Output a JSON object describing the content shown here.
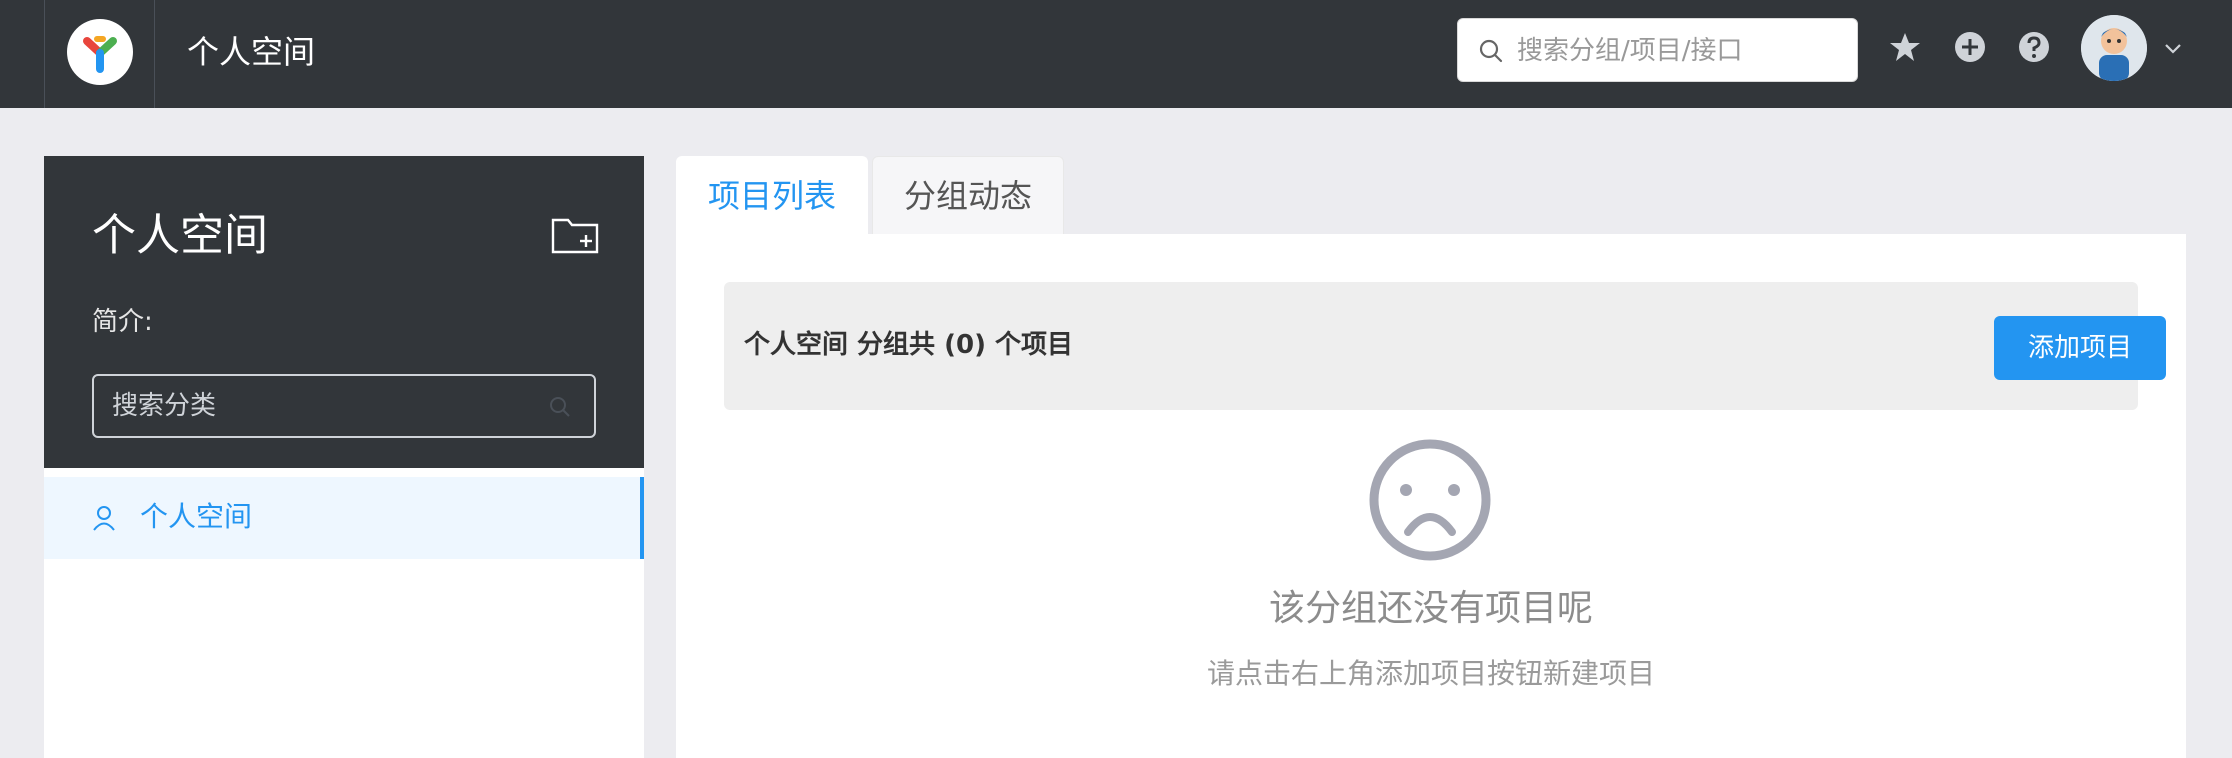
{
  "header": {
    "title": "个人空间",
    "search_placeholder": "搜索分组/项目/接口",
    "icons": [
      "logo-icon",
      "star-icon",
      "plus-circle-icon",
      "help-icon",
      "avatar",
      "chevron-down-icon"
    ]
  },
  "sidebar": {
    "title": "个人空间",
    "intro_label": "简介:",
    "search_placeholder": "搜索分类",
    "items": [
      {
        "label": "个人空间",
        "icon": "user-icon",
        "active": true
      }
    ]
  },
  "tabs": [
    {
      "label": "项目列表",
      "active": true
    },
    {
      "label": "分组动态",
      "active": false
    }
  ],
  "main": {
    "summary": "个人空间 分组共 (0) 个项目",
    "add_button": "添加项目",
    "empty_title": "该分组还没有项目呢",
    "empty_subtitle": "请点击右上角添加项目按钮新建项目"
  },
  "colors": {
    "header_bg": "#32363a",
    "accent": "#2395f1",
    "page_bg": "#ececf0"
  }
}
